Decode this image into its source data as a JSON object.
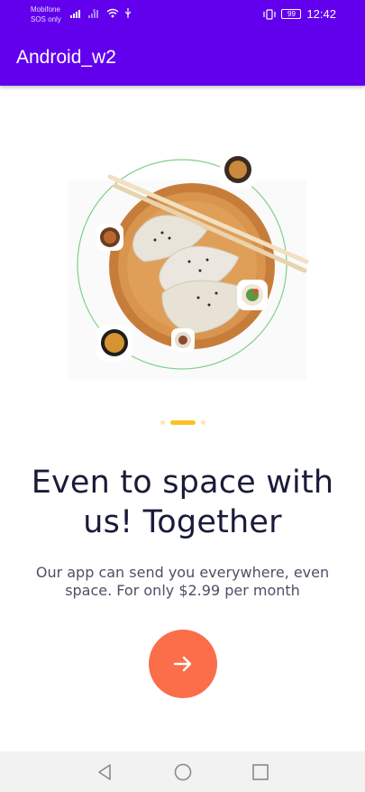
{
  "status_bar": {
    "carrier_line1": "Mobifone",
    "carrier_line2": "SOS only",
    "battery": "99",
    "time": "12:42"
  },
  "app_bar": {
    "title": "Android_w2"
  },
  "onboarding": {
    "page_indicator": {
      "count": 3,
      "active_index": 1
    },
    "headline_line1": "Even to space with",
    "headline_line2": "us! Together",
    "subtitle_line1": "Our app can send you everywhere, even",
    "subtitle_line2": "space. For only $2.99 per month",
    "next_icon": "arrow-right-icon"
  },
  "colors": {
    "primary": "#6200ee",
    "accent_button": "#fa6e4a",
    "indicator_active": "#f9c324",
    "indicator_inactive": "#fde7b0",
    "ring": "#7ed08a",
    "headline": "#1a1b3a"
  },
  "nav_bar": {
    "back_icon": "back-triangle-icon",
    "home_icon": "home-circle-icon",
    "recents_icon": "recents-square-icon"
  }
}
